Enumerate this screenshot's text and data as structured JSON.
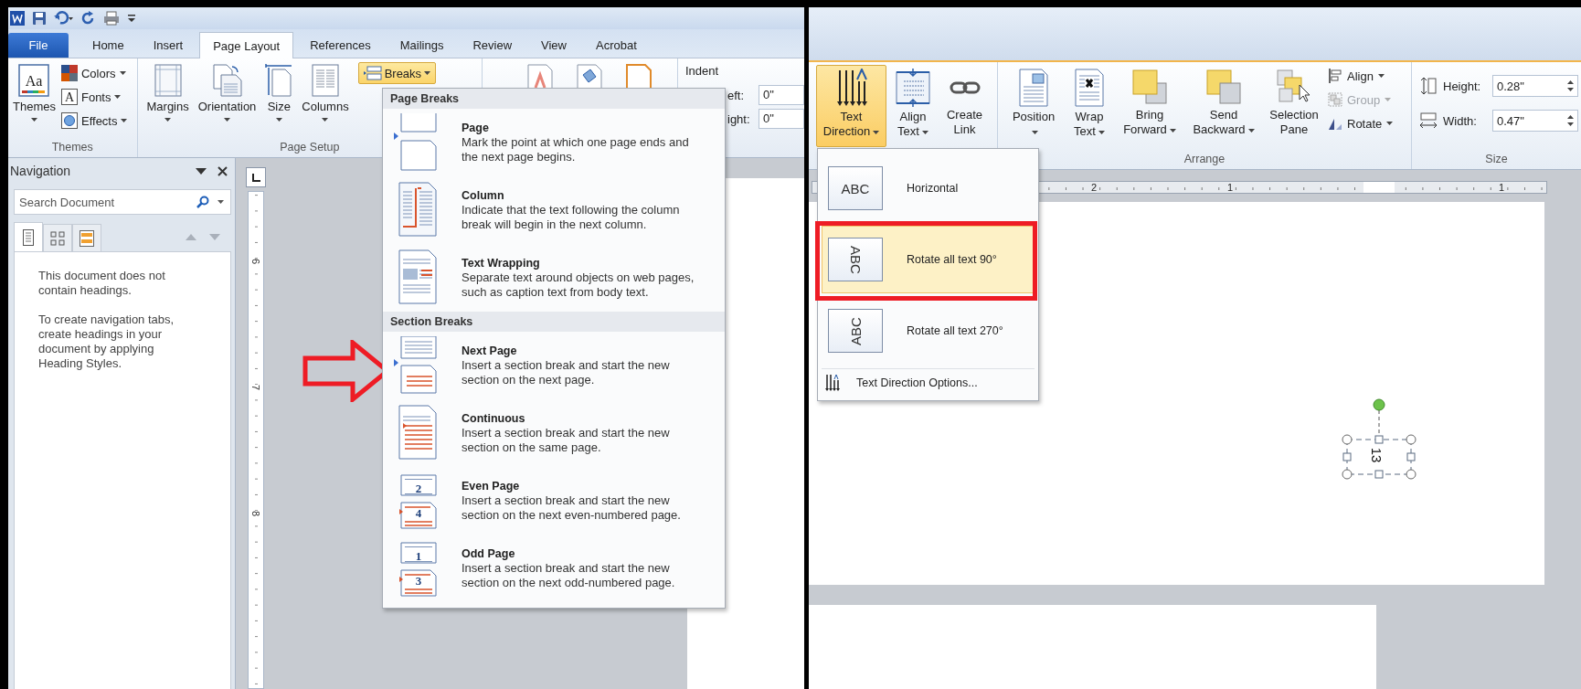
{
  "left_window": {
    "tabs": [
      {
        "label": "File",
        "kind": "file",
        "selected": false
      },
      {
        "label": "Home",
        "kind": "tab",
        "selected": false
      },
      {
        "label": "Insert",
        "kind": "tab",
        "selected": false
      },
      {
        "label": "Page Layout",
        "kind": "tab",
        "selected": true
      },
      {
        "label": "References",
        "kind": "tab",
        "selected": false
      },
      {
        "label": "Mailings",
        "kind": "tab",
        "selected": false
      },
      {
        "label": "Review",
        "kind": "tab",
        "selected": false
      },
      {
        "label": "View",
        "kind": "tab",
        "selected": false
      },
      {
        "label": "Acrobat",
        "kind": "tab",
        "selected": false
      }
    ],
    "themes_group": {
      "label": "Themes",
      "button": "Themes",
      "icon_text": "Aa",
      "options": [
        {
          "label": "Colors",
          "kind": "colors"
        },
        {
          "label": "Fonts",
          "kind": "fonts",
          "icon_text": "A"
        },
        {
          "label": "Effects",
          "kind": "effects"
        }
      ]
    },
    "page_setup_group": {
      "label": "Page Setup",
      "buttons": [
        {
          "label": "Margins",
          "kind": "margins"
        },
        {
          "label": "Orientation",
          "kind": "orientation"
        },
        {
          "label": "Size",
          "kind": "size"
        },
        {
          "label": "Columns",
          "kind": "columns"
        }
      ],
      "breaks": {
        "label": "Breaks",
        "selected": true
      }
    },
    "indent_group": {
      "label": "Indent",
      "fields": [
        {
          "label": "eft:",
          "value": "0\""
        },
        {
          "label": "ight:",
          "value": "0\""
        }
      ]
    },
    "navigation": {
      "title": "Navigation",
      "search": {
        "placeholder": "Search Document"
      },
      "tabs": [
        {
          "kind": "headings",
          "selected": true
        },
        {
          "kind": "pages",
          "selected": false
        },
        {
          "kind": "results",
          "selected": false
        }
      ],
      "messages": [
        "This document does not contain headings.",
        "To create navigation tabs, create headings in your document by applying Heading Styles."
      ]
    },
    "ruler_labels": [
      "6",
      "7",
      "8"
    ],
    "breaks_menu": {
      "sections": [
        {
          "title": "Page Breaks",
          "items": [
            {
              "kind": "page",
              "title": "Page",
              "description": "Mark the point at which one page ends and the next page begins."
            },
            {
              "kind": "column",
              "title": "Column",
              "description": "Indicate that the text following the column break will begin in the next column."
            },
            {
              "kind": "text-wrapping",
              "title": "Text Wrapping",
              "description": "Separate text around objects on web pages, such as caption text from body text."
            }
          ]
        },
        {
          "title": "Section Breaks",
          "items": [
            {
              "kind": "next-page",
              "title": "Next Page",
              "description": "Insert a section break and start the new section on the next page."
            },
            {
              "kind": "continuous",
              "title": "Continuous",
              "description": "Insert a section break and start the new section on the same page."
            },
            {
              "kind": "even-page",
              "title": "Even Page",
              "description": "Insert a section break and start the new section on the next even-numbered page.",
              "icon_numbers": [
                "2",
                "4"
              ]
            },
            {
              "kind": "odd-page",
              "title": "Odd Page",
              "description": "Insert a section break and start the new section on the next odd-numbered page.",
              "icon_numbers": [
                "1",
                "3"
              ]
            }
          ]
        }
      ]
    }
  },
  "right_window": {
    "text_group": [
      {
        "label": "Text Direction",
        "kind": "text-direction",
        "selected": true
      },
      {
        "label": "Align Text",
        "kind": "align-text",
        "selected": false
      },
      {
        "label": "Create Link",
        "kind": "create-link",
        "selected": false
      }
    ],
    "arrange_group": {
      "label": "Arrange",
      "buttons": [
        {
          "label": "Position",
          "kind": "position"
        },
        {
          "label": "Wrap Text",
          "kind": "wrap-text"
        },
        {
          "label": "Bring Forward",
          "kind": "bring-forward"
        },
        {
          "label": "Send Backward",
          "kind": "send-backward"
        },
        {
          "label": "Selection Pane",
          "kind": "selection-pane"
        }
      ],
      "small_buttons": [
        {
          "label": "Align",
          "kind": "align",
          "disabled": false
        },
        {
          "label": "Group",
          "kind": "group",
          "disabled": true
        },
        {
          "label": "Rotate",
          "kind": "rotate",
          "disabled": false
        }
      ]
    },
    "size_group": {
      "label": "Size",
      "fields": [
        {
          "label": "Height:",
          "kind": "height",
          "value": "0.28\""
        },
        {
          "label": "Width:",
          "kind": "width",
          "value": "0.47\""
        }
      ]
    },
    "ruler_labels": [
      "2",
      "1",
      "1"
    ],
    "text_direction_menu": {
      "items": [
        {
          "label": "Horizontal",
          "kind": "horizontal",
          "preview": "ABC",
          "selected": false
        },
        {
          "label": "Rotate all text 90°",
          "kind": "rotate-90",
          "preview": "ABC",
          "selected": true
        },
        {
          "label": "Rotate all text 270°",
          "kind": "rotate-270",
          "preview": "ABC",
          "selected": false
        }
      ],
      "footer": "Text Direction Options..."
    },
    "text_box": {
      "text": "13"
    }
  }
}
